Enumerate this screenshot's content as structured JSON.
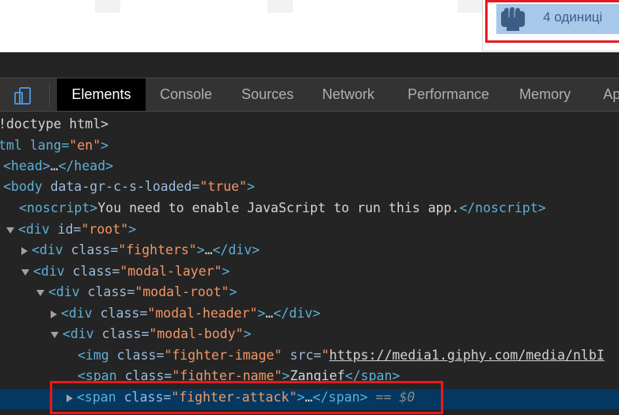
{
  "page": {
    "tooltip_text": "4 одиниці",
    "icon": "fist-icon"
  },
  "devtools": {
    "device_icon": "device-toggle-icon",
    "tabs": [
      "Elements",
      "Console",
      "Sources",
      "Network",
      "Performance",
      "Memory",
      "Ap"
    ],
    "active_tab": "Elements",
    "dom": {
      "l0": "!doctype html>",
      "l1_open": "tml lang=",
      "l1_val": "\"en\"",
      "l1_close": ">",
      "l2_tag": "<head>",
      "l2_ell": "…",
      "l2_end": "</head>",
      "l3_tag": "<body ",
      "l3_attr": "data-gr-c-s-loaded=",
      "l3_val": "\"true\"",
      "l3_close": ">",
      "l4_tag": "<noscript>",
      "l4_text": "You need to enable JavaScript to run this app.",
      "l4_end": "</noscript>",
      "l5_tag": "<div ",
      "l5_attr": "id=",
      "l5_val": "\"root\"",
      "l5_close": ">",
      "l6_tag": "<div ",
      "l6_attr": "class=",
      "l6_val": "\"fighters\"",
      "l6_close": ">",
      "l6_ell": "…",
      "l6_end": "</div>",
      "l7_tag": "<div ",
      "l7_attr": "class=",
      "l7_val": "\"modal-layer\"",
      "l7_close": ">",
      "l8_tag": "<div ",
      "l8_attr": "class=",
      "l8_val": "\"modal-root\"",
      "l8_close": ">",
      "l9_tag": "<div ",
      "l9_attr": "class=",
      "l9_val": "\"modal-header\"",
      "l9_close": ">",
      "l9_ell": "…",
      "l9_end": "</div>",
      "l10_tag": "<div ",
      "l10_attr": "class=",
      "l10_val": "\"modal-body\"",
      "l10_close": ">",
      "l11_tag": "<img ",
      "l11_attr": "class=",
      "l11_val": "\"fighter-image\"",
      "l11_attr2": " src=",
      "l11_q": "\"",
      "l11_link": "https://media1.giphy.com/media/nlbI",
      "l12_tag": "<span ",
      "l12_attr": "class=",
      "l12_val": "\"fighter-name\"",
      "l12_close": ">",
      "l12_text": "Zangief",
      "l12_end": "</span>",
      "l13_tag": "<span ",
      "l13_attr": "class=",
      "l13_val": "\"fighter-attack\"",
      "l13_close": ">",
      "l13_ell": "…",
      "l13_end": "</span>",
      "l13_eq": " == $0"
    }
  },
  "colors": {
    "highlight_border": "#e8191e",
    "selection_bg": "#043860",
    "tag": "#5db0d7",
    "attr_value": "#f29766"
  }
}
